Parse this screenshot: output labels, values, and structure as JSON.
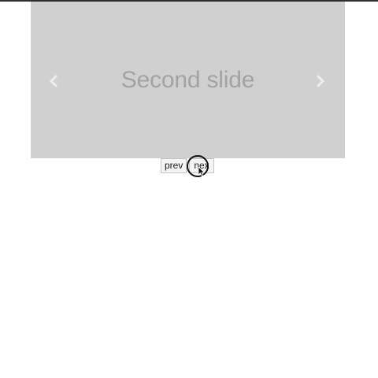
{
  "carousel": {
    "current_slide_caption": "Second slide",
    "prev_arrow_icon": "chevron-left-icon",
    "next_arrow_icon": "chevron-right-icon"
  },
  "controls": {
    "prev_label": "prev",
    "next_label": "nex"
  },
  "cursor": {
    "icon": "mouse-pointer-icon"
  },
  "colors": {
    "slide_background": "#d0d0d0",
    "caption": "#a3a3a3",
    "top_bar": "#2f2f2f"
  }
}
